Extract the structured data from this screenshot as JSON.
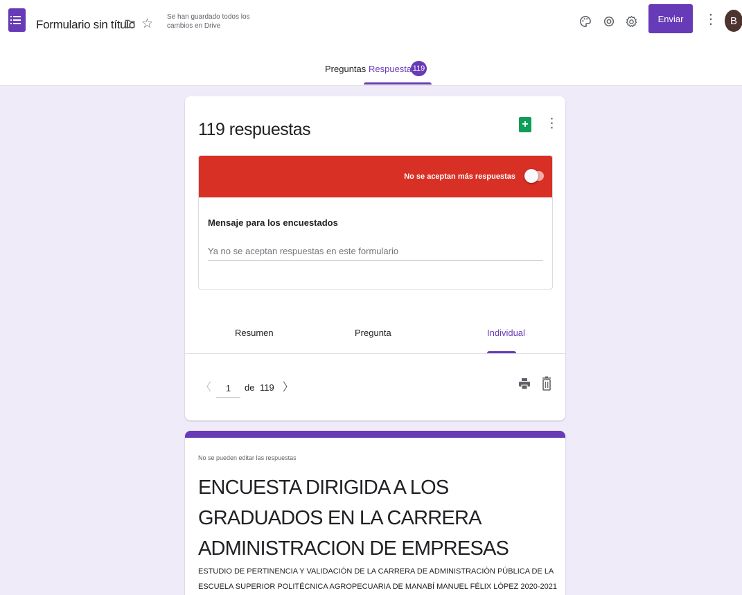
{
  "header": {
    "title": "Formulario sin título",
    "saved_status": "Se han guardado todos los cambios en Drive",
    "send_label": "Enviar",
    "avatar_initial": "B",
    "accent_color": "#673ab7"
  },
  "nav": {
    "tabs": [
      {
        "label": "Preguntas"
      },
      {
        "label": "Respuestas"
      }
    ],
    "responses_count": "119"
  },
  "responses": {
    "title": "119 respuestas",
    "accepting_label": "No se aceptan más respuestas",
    "accepting": false,
    "message_label": "Mensaje para los encuestados",
    "message_placeholder": "Ya no se aceptan respuestas en este formulario",
    "view_tabs": [
      {
        "label": "Resumen"
      },
      {
        "label": "Pregunta"
      },
      {
        "label": "Individual"
      }
    ],
    "pager": {
      "current": "1",
      "of_label": "de",
      "total": "119"
    }
  },
  "form_preview": {
    "notice": "No se pueden editar las respuestas",
    "title": "ENCUESTA DIRIGIDA A LOS GRADUADOS EN LA CARRERA ADMINISTRACION DE EMPRESAS",
    "description": "ESTUDIO DE PERTINENCIA Y VALIDACIÓN DE LA CARRERA DE ADMINISTRACIÓN PÚBLICA DE LA ESCUELA SUPERIOR POLITÉCNICA AGROPECUARIA DE MANABÍ MANUEL FÉLIX LÓPEZ  2020-2021"
  },
  "icons": [
    "forms-app-icon",
    "folder-icon",
    "star-icon",
    "palette-icon",
    "preview-icon",
    "settings-icon",
    "more-vert-icon",
    "sheets-icon",
    "print-icon",
    "trash-icon",
    "chevron-left-icon",
    "chevron-right-icon"
  ]
}
